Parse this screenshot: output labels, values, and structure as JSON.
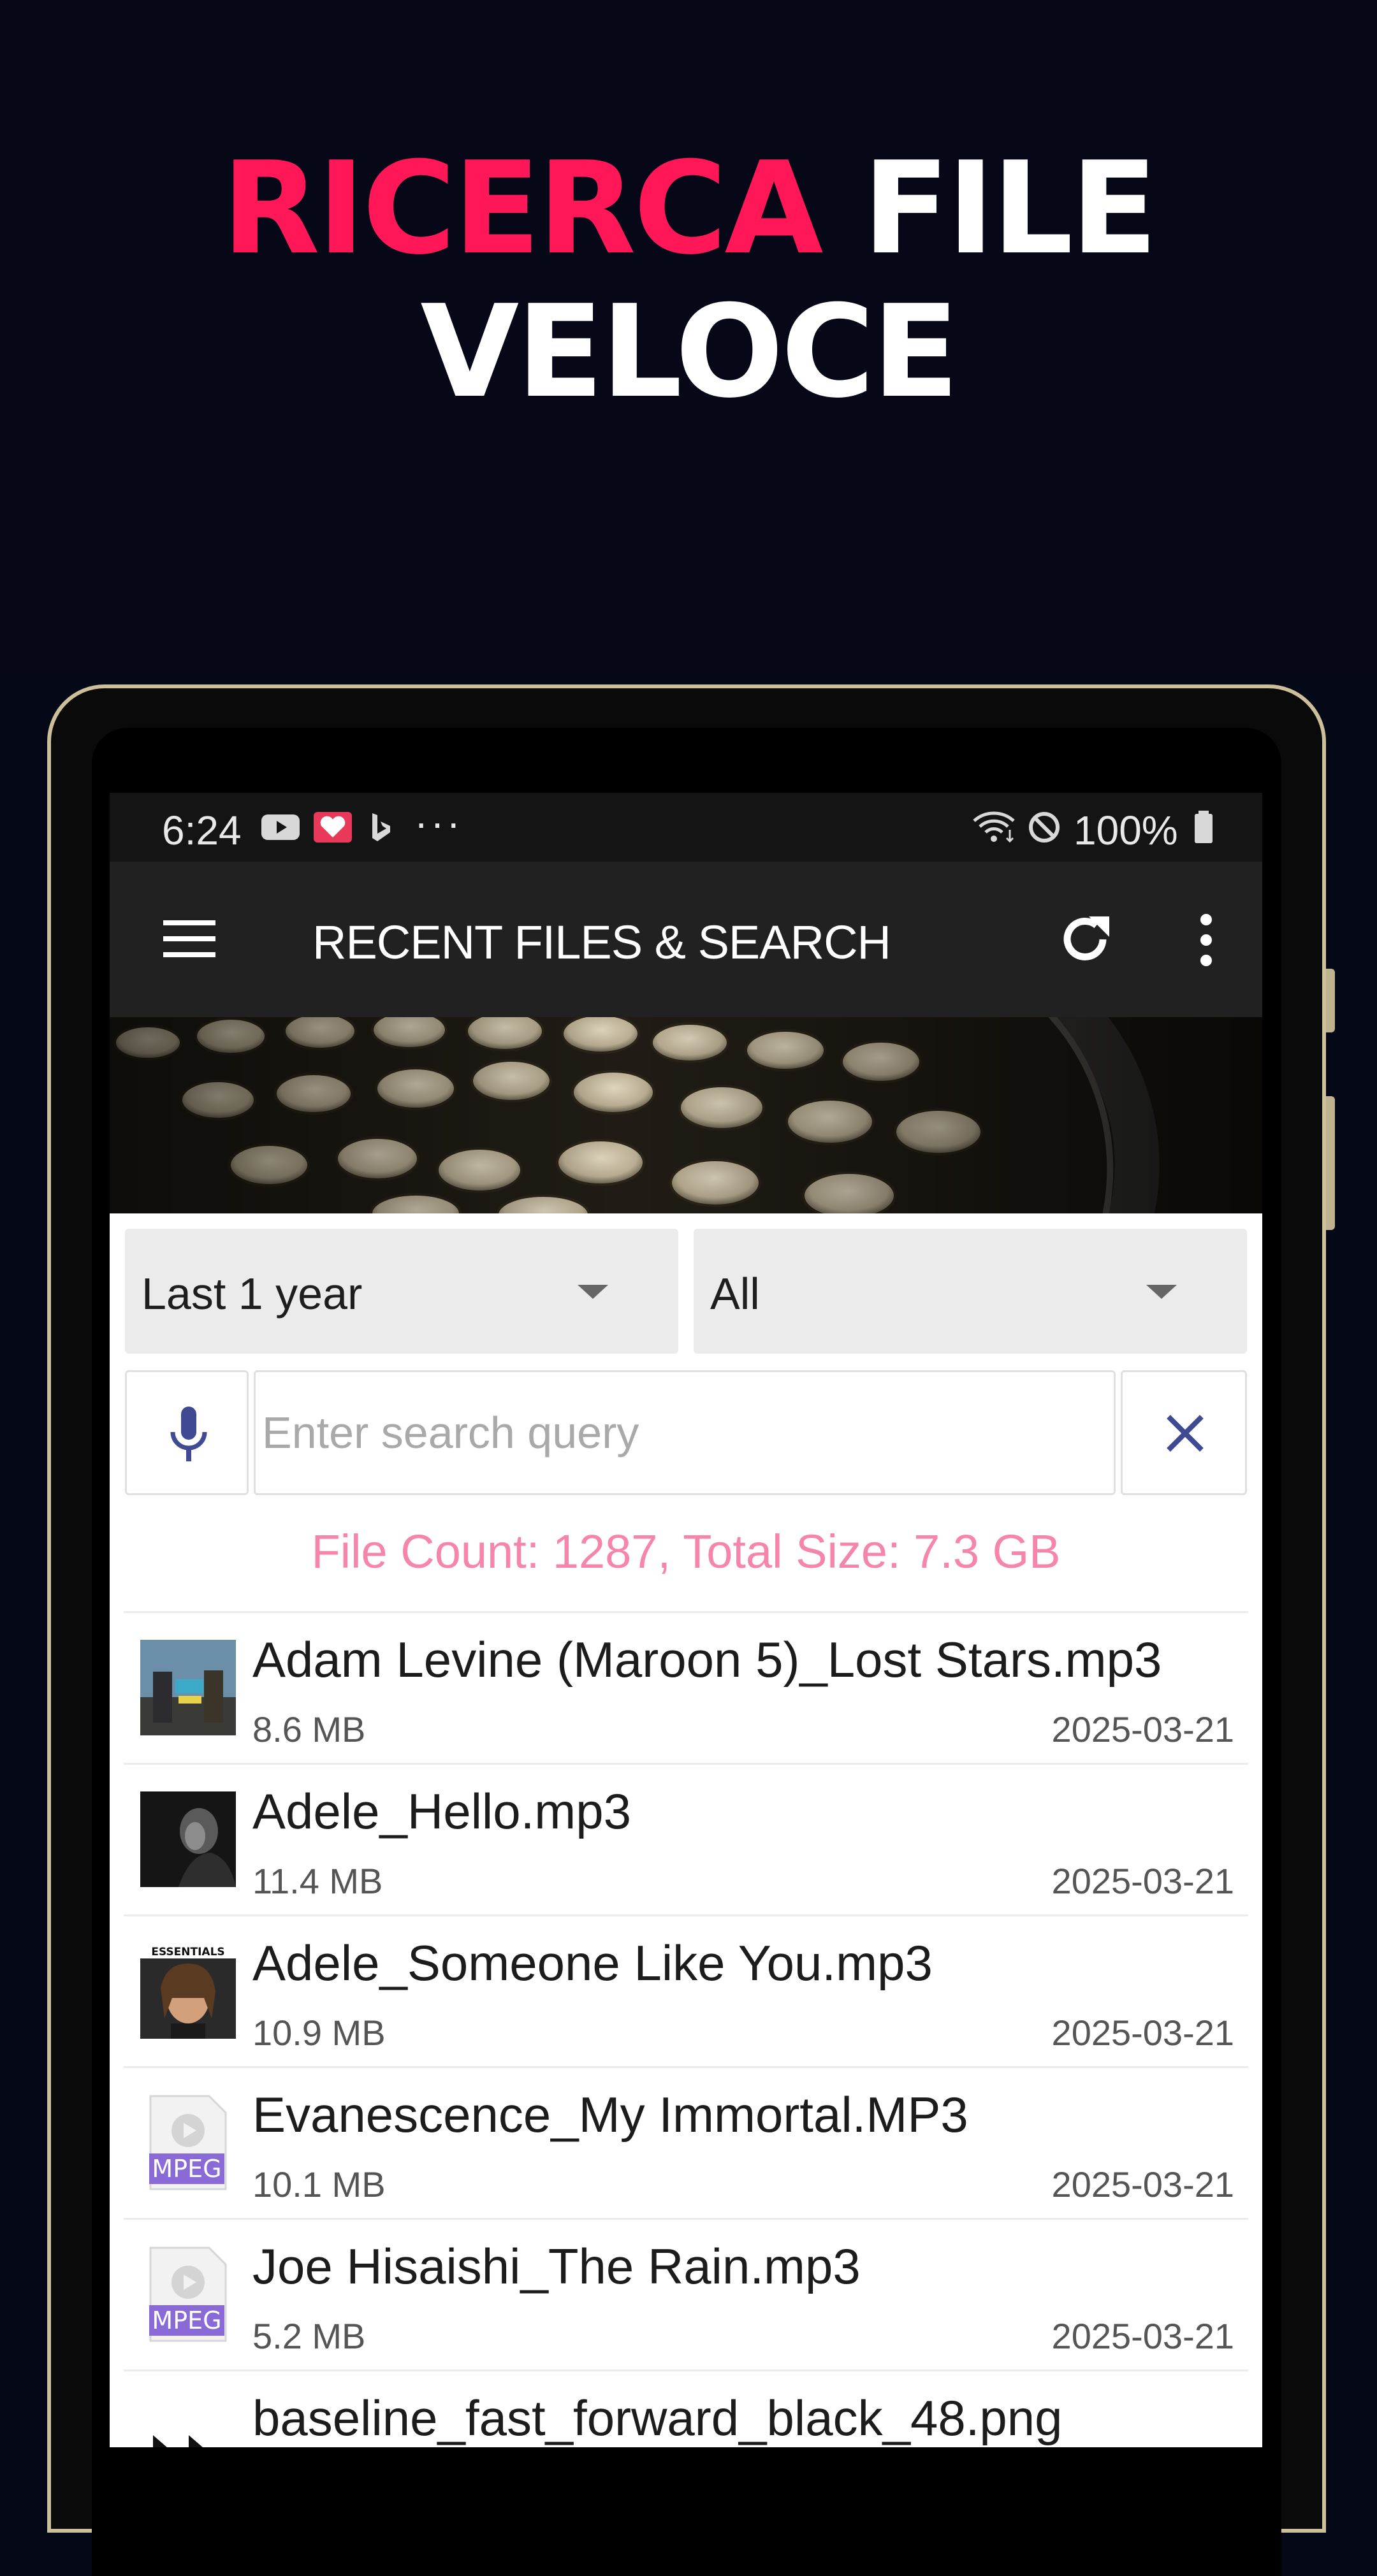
{
  "promo": {
    "headline_accent": "RICERCA",
    "headline_rest": " FILE",
    "headline_line2": "VELOCE",
    "accent_color": "#ff1757"
  },
  "statusbar": {
    "time": "6:24",
    "battery": "100%",
    "overflow": "···",
    "icons": [
      "youtube-icon",
      "heart-app-icon",
      "bing-icon",
      "more-dots-icon",
      "wifi-icon",
      "do-not-disturb-icon",
      "battery-icon"
    ]
  },
  "appbar": {
    "title": "RECENT FILES & SEARCH",
    "icons": [
      "menu-icon",
      "refresh-icon",
      "more-vert-icon"
    ]
  },
  "filters": {
    "period": "Last 1 year",
    "type": "All"
  },
  "search": {
    "placeholder": "Enter search query",
    "value": ""
  },
  "summary": {
    "text": "File Count: 1287, Total Size: 7.3 GB",
    "color": "#f585ab"
  },
  "files": [
    {
      "name": "Adam Levine (Maroon 5)_Lost Stars.mp3",
      "size": "8.6 MB",
      "date": "2025-03-21",
      "thumb": "album-art-begin-again"
    },
    {
      "name": "Adele_Hello.mp3",
      "size": "11.4 MB",
      "date": "2025-03-21",
      "thumb": "album-art-adele-25"
    },
    {
      "name": "Adele_Someone Like You.mp3",
      "size": "10.9 MB",
      "date": "2025-03-21",
      "thumb": "album-art-essentials",
      "thumb_text": "ESSENTIALS"
    },
    {
      "name": "Evanescence_My Immortal.MP3",
      "size": "10.1 MB",
      "date": "2025-03-21",
      "thumb": "mpeg-file-icon",
      "thumb_text": "MPEG"
    },
    {
      "name": "Joe Hisaishi_The Rain.mp3",
      "size": "5.2 MB",
      "date": "2025-03-21",
      "thumb": "mpeg-file-icon",
      "thumb_text": "MPEG"
    },
    {
      "name": "baseline_fast_forward_black_48.png",
      "size": "",
      "date": "",
      "thumb": "fast-forward-icon"
    }
  ]
}
